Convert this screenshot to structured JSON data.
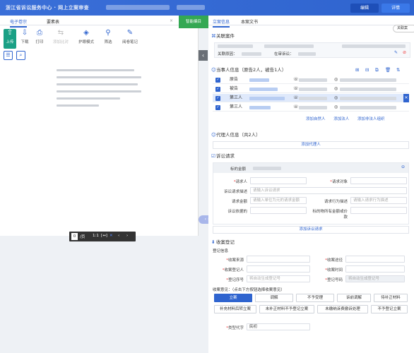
{
  "app": {
    "title": "浙江省诉讼服务中心 · 网上立案审查",
    "edit_label": "编辑",
    "detail_label": "详情"
  },
  "left": {
    "tabs": [
      "电子卷宗",
      "要素表"
    ],
    "close_x": "×",
    "green_button": "智能编目",
    "toolbar": [
      {
        "icon": "upload-icon",
        "label": "上传",
        "glyph": "⇧"
      },
      {
        "icon": "download-icon",
        "label": "下载",
        "glyph": "⇩"
      },
      {
        "icon": "print-icon",
        "label": "打印",
        "glyph": "⎙"
      },
      {
        "icon": "compare-icon",
        "label": "添加比对",
        "glyph": "⇆"
      },
      {
        "icon": "shield-icon",
        "label": "护眼模式",
        "glyph": "◈"
      },
      {
        "icon": "filter-icon",
        "label": "筛选",
        "glyph": "⚲"
      },
      {
        "icon": "note-icon",
        "label": "阅卷笔记",
        "glyph": "✎"
      }
    ],
    "pager": {
      "page": "0",
      "total": "/页",
      "fit": "1:1"
    }
  },
  "right": {
    "tabs": [
      "立案信息",
      "本案文书"
    ],
    "side_pill": "关联案",
    "case_section": {
      "title": "关联案件",
      "field1": "关联原因：",
      "field2": "在审诉讼："
    },
    "party_section": {
      "title": "当事人信息（原告2人，被告1人）",
      "rows": [
        {
          "role": "原告",
          "name": "张某某"
        },
        {
          "role": "被告",
          "name": "李某某"
        },
        {
          "role": "第三人",
          "name": "王某某"
        },
        {
          "role": "第三人",
          "name": "赵某某"
        }
      ],
      "add_links": [
        "添加自然人",
        "添加法人",
        "添加非法人组织"
      ]
    },
    "agent_section": {
      "title": "代理人信息（共2人）",
      "add": "添加代理人"
    },
    "claim_section": {
      "title": "诉讼请求",
      "amount_label": "标的金额",
      "plaintiff_label": "请求人",
      "target_label": "请求对象",
      "content_label": "诉讼请求描述",
      "content_ph": "请输入诉讼请求",
      "money_label": "请求金额",
      "money_ph": "请输入单位为元的请求金额",
      "amount2_label": "请求行为描述",
      "amount2_ph": "请输入请求行为描述",
      "basis_label": "诉讼依据的",
      "basis2_label": "标的物所有金额或价款",
      "add": "添加诉讼请求"
    },
    "reg_section": {
      "title": "收案登记",
      "subtitle": "登记信息",
      "src_label": "收案来源",
      "src_date_label": "收案途径",
      "handler_label": "收案登记人",
      "date_label": "收案时间",
      "reg_no_label": "登记序号",
      "reg_no_ph": "将自动生成登记号",
      "reg_no2_label": "登记号码",
      "reg_no2_val": "将自动生成登记号",
      "opinion_label": "收案意见：（点击下方按钮选择收案意见）",
      "buttons": [
        "立案",
        "调解",
        "不予受理",
        "诉前调解",
        "待补正材料",
        "补充材料后转立案",
        "未补正材料不予登记立案",
        "未缴纳诉费撤诉处理",
        "不予登记立案"
      ],
      "type_label": "类型代字",
      "type_val": "民初"
    }
  }
}
